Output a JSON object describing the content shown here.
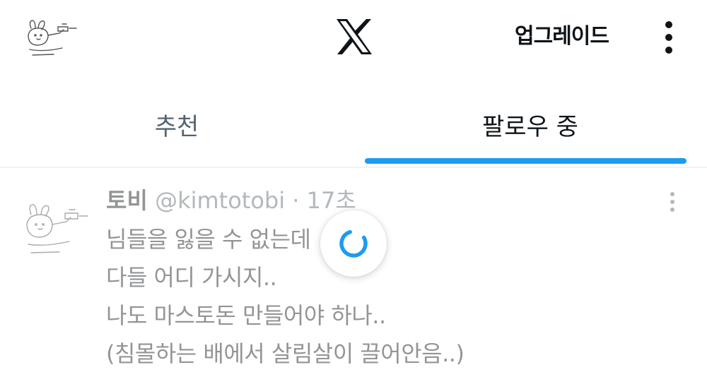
{
  "header": {
    "avatar_icon": "doodle-rabbit-avatar",
    "logo_icon": "x-logo-icon",
    "upgrade_label": "업그레이드",
    "more_icon": "vertical-ellipsis-icon"
  },
  "tabs": [
    {
      "label": "추천",
      "selected": false
    },
    {
      "label": "팔로우 중",
      "selected": true
    }
  ],
  "post": {
    "author_name": "토비",
    "author_handle": "@kimtotobi",
    "separator": "·",
    "time": "17초",
    "lines": [
      "님들을 잃을 수 없는데",
      "다들 어디 가시지..",
      "나도 마스토돈 만들어야 하나..",
      "(침몰하는 배에서 살림살이 끌어안음..)"
    ],
    "menu_icon": "vertical-ellipsis-icon"
  },
  "loading": {
    "icon": "loading-spinner-icon"
  },
  "colors": {
    "accent": "#1d9bf0",
    "text_primary": "#0f1419",
    "text_secondary": "#536471",
    "divider": "#eff3f4"
  }
}
